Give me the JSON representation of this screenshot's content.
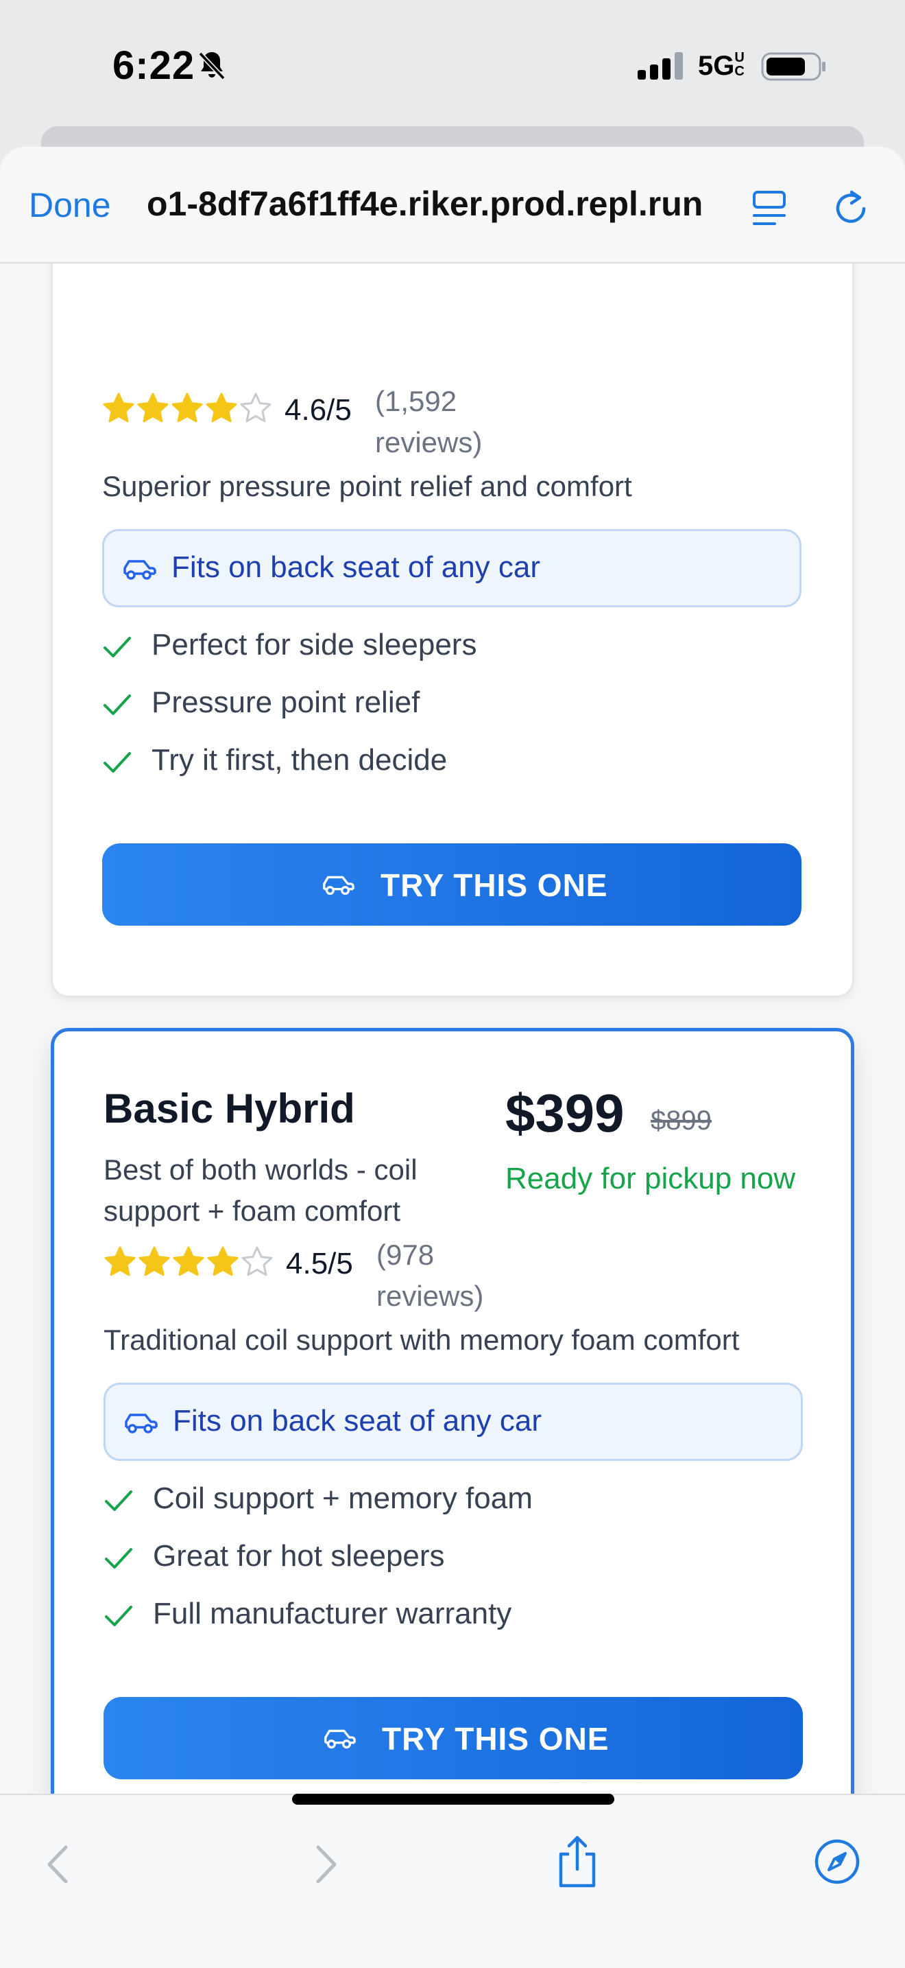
{
  "status_bar": {
    "time": "6:22",
    "network": "5G",
    "network_superscript": "UC"
  },
  "browser": {
    "done_label": "Done",
    "url": "o1-8df7a6f1ff4e.riker.prod.repl.run"
  },
  "products": [
    {
      "rating_stars": 4,
      "rating": "4.6/5",
      "reviews_line1": "(1,592",
      "reviews_line2": "reviews)",
      "description": "Superior pressure point relief and comfort",
      "fit_badge": "Fits on back seat of any car",
      "features": [
        "Perfect for side sleepers",
        "Pressure point relief",
        "Try it first, then decide"
      ],
      "cta": "TRY THIS ONE"
    },
    {
      "name": "Basic Hybrid",
      "tagline": "Best of both worlds - coil support + foam comfort",
      "price": "$399",
      "old_price": "$899",
      "availability": "Ready for pickup now",
      "rating_stars": 4,
      "rating": "4.5/5",
      "reviews_line1": "(978",
      "reviews_line2": "reviews)",
      "description": "Traditional coil support with memory foam comfort",
      "fit_badge": "Fits on back seat of any car",
      "features": [
        "Coil support + memory foam",
        "Great for hot sleepers",
        "Full manufacturer warranty"
      ],
      "cta": "TRY THIS ONE"
    }
  ],
  "colors": {
    "accent": "#1f7ae0",
    "cta": "#1a73e8",
    "success": "#16a34a",
    "star": "#f5c518",
    "badge_text": "#1e40af"
  },
  "icons": {
    "bell": "bell-slash-icon",
    "signal": "cellular-signal-icon",
    "battery": "battery-icon",
    "reader": "reader-mode-icon",
    "reload": "reload-icon",
    "car": "car-icon",
    "check": "check-icon",
    "back": "chevron-left-icon",
    "forward": "chevron-right-icon",
    "share": "share-icon",
    "compass": "compass-icon"
  }
}
